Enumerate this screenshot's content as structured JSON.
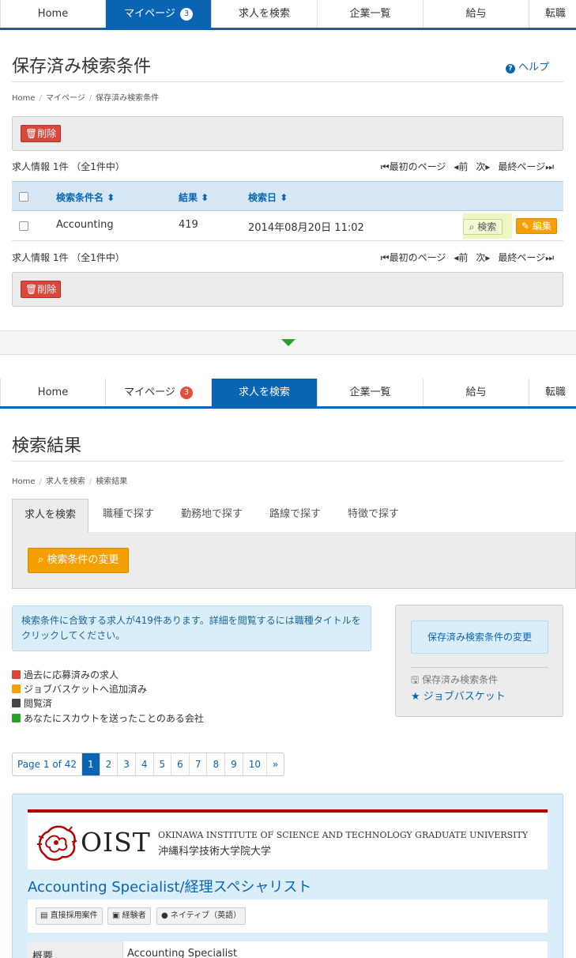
{
  "nav_top": {
    "tabs": [
      {
        "label": "Home"
      },
      {
        "label": "マイページ",
        "badge": "3"
      },
      {
        "label": "求人を検索"
      },
      {
        "label": "企業一覧"
      },
      {
        "label": "給与"
      },
      {
        "label": "転職"
      }
    ],
    "active": "マイページ"
  },
  "saved": {
    "title": "保存済み検索条件",
    "help": "ヘルプ",
    "breadcrumb": [
      "Home",
      "マイページ",
      "保存済み検索条件"
    ],
    "delete_label": "削除",
    "count_text": "求人情報 1件 （全1件中）",
    "pager": {
      "first": "最初のページ",
      "prev": "前",
      "next": "次",
      "last": "最終ページ"
    },
    "columns": [
      "検索条件名",
      "結果",
      "検索日"
    ],
    "rows": [
      {
        "name": "Accounting",
        "result": "419",
        "date": "2014年08月20日 11:02",
        "search_label": "検索",
        "edit_label": "編集"
      }
    ]
  },
  "nav_bottom": {
    "tabs": [
      {
        "label": "Home"
      },
      {
        "label": "マイページ",
        "badge": "3"
      },
      {
        "label": "求人を検索"
      },
      {
        "label": "企業一覧"
      },
      {
        "label": "給与"
      },
      {
        "label": "転職"
      }
    ],
    "active": "求人を検索"
  },
  "results": {
    "title": "検索結果",
    "breadcrumb": [
      "Home",
      "求人を検索",
      "検索結果"
    ],
    "subtabs": [
      "求人を検索",
      "職種で探す",
      "勤務地で探す",
      "路線で探す",
      "特徴で探す"
    ],
    "change_button": "検索条件の変更",
    "info": "検索条件に合致する求人が419件あります。詳細を閲覧するには職種タイトルをクリックしてください。",
    "sidebox": {
      "button": "保存済み検索条件の変更",
      "saved_link": "保存済み検索条件",
      "basket_link": "ジョブバスケット"
    },
    "legend": [
      {
        "label": "過去に応募済みの求人",
        "color": "#d9463a"
      },
      {
        "label": "ジョブバスケットへ追加済み",
        "color": "#f5a000"
      },
      {
        "label": "閲覧済",
        "color": "#444444"
      },
      {
        "label": "あなたにスカウトを送ったことのある会社",
        "color": "#2ca02c"
      }
    ],
    "pagination": {
      "summary": "Page 1 of 42",
      "pages": [
        "1",
        "2",
        "3",
        "4",
        "5",
        "6",
        "7",
        "8",
        "9",
        "10"
      ],
      "current": "1",
      "next": "»"
    },
    "job": {
      "logo_text": "OIST",
      "logo_en": "OKINAWA INSTITUTE OF SCIENCE AND TECHNOLOGY GRADUATE UNIVERSITY",
      "logo_ja": "沖縄科学技術大学院大学",
      "title": "Accounting Specialist/経理スペシャリスト",
      "tags": [
        "直接採用案件",
        "経験者",
        "ネイティブ（英語）"
      ],
      "detail_key": "概要",
      "detail_value": "Accounting Specialist"
    }
  },
  "colors": {
    "brand": "#0a64b4",
    "delete": "#d9463a",
    "accent": "#f5a000"
  }
}
